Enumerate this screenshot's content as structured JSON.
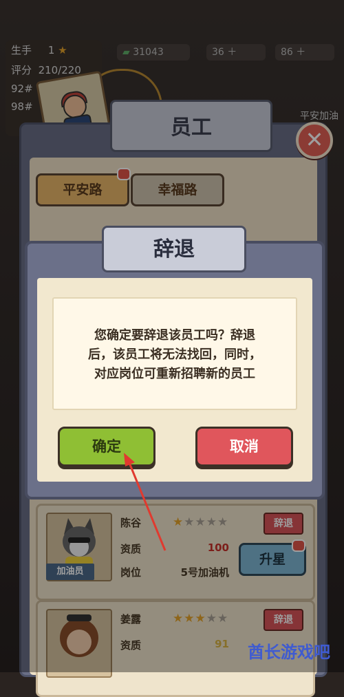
{
  "hud": {
    "rank_label": "生手",
    "rank_value": "1",
    "score_label": "评分",
    "score_value": "210/220",
    "line3": "92#",
    "line4": "98#",
    "money": "31043",
    "gems": "36",
    "energy": "86",
    "header_right": "平安加油"
  },
  "panel": {
    "title": "员工",
    "tabs": [
      {
        "label": "平安路",
        "active": true
      },
      {
        "label": "幸福路",
        "active": false
      }
    ]
  },
  "dialog": {
    "title": "辞退",
    "message_line1": "您确定要辞退该员工吗？辞退",
    "message_line2": "后，该员工将无法找回，同时，",
    "message_line3": "对应岗位可重新招聘新的员工",
    "confirm_label": "确定",
    "cancel_label": "取消"
  },
  "employees": [
    {
      "name": "陈谷",
      "stars_filled": 1,
      "stars_total": 5,
      "dismiss_label": "辞退",
      "quality_label": "资质",
      "quality_value": "100",
      "position_label": "岗位",
      "position_value": "5号加油机",
      "role_tag": "加油员",
      "upgrade_label": "升星"
    },
    {
      "name": "姜露",
      "stars_filled": 3,
      "stars_total": 5,
      "dismiss_label": "辞退",
      "quality_label": "资质",
      "quality_value": "91"
    }
  ],
  "watermark": "酋长游戏吧",
  "colors": {
    "confirm": "#8fbf34",
    "cancel": "#e0565c",
    "panel": "#6b7089",
    "arrow": "#e03a2f"
  }
}
